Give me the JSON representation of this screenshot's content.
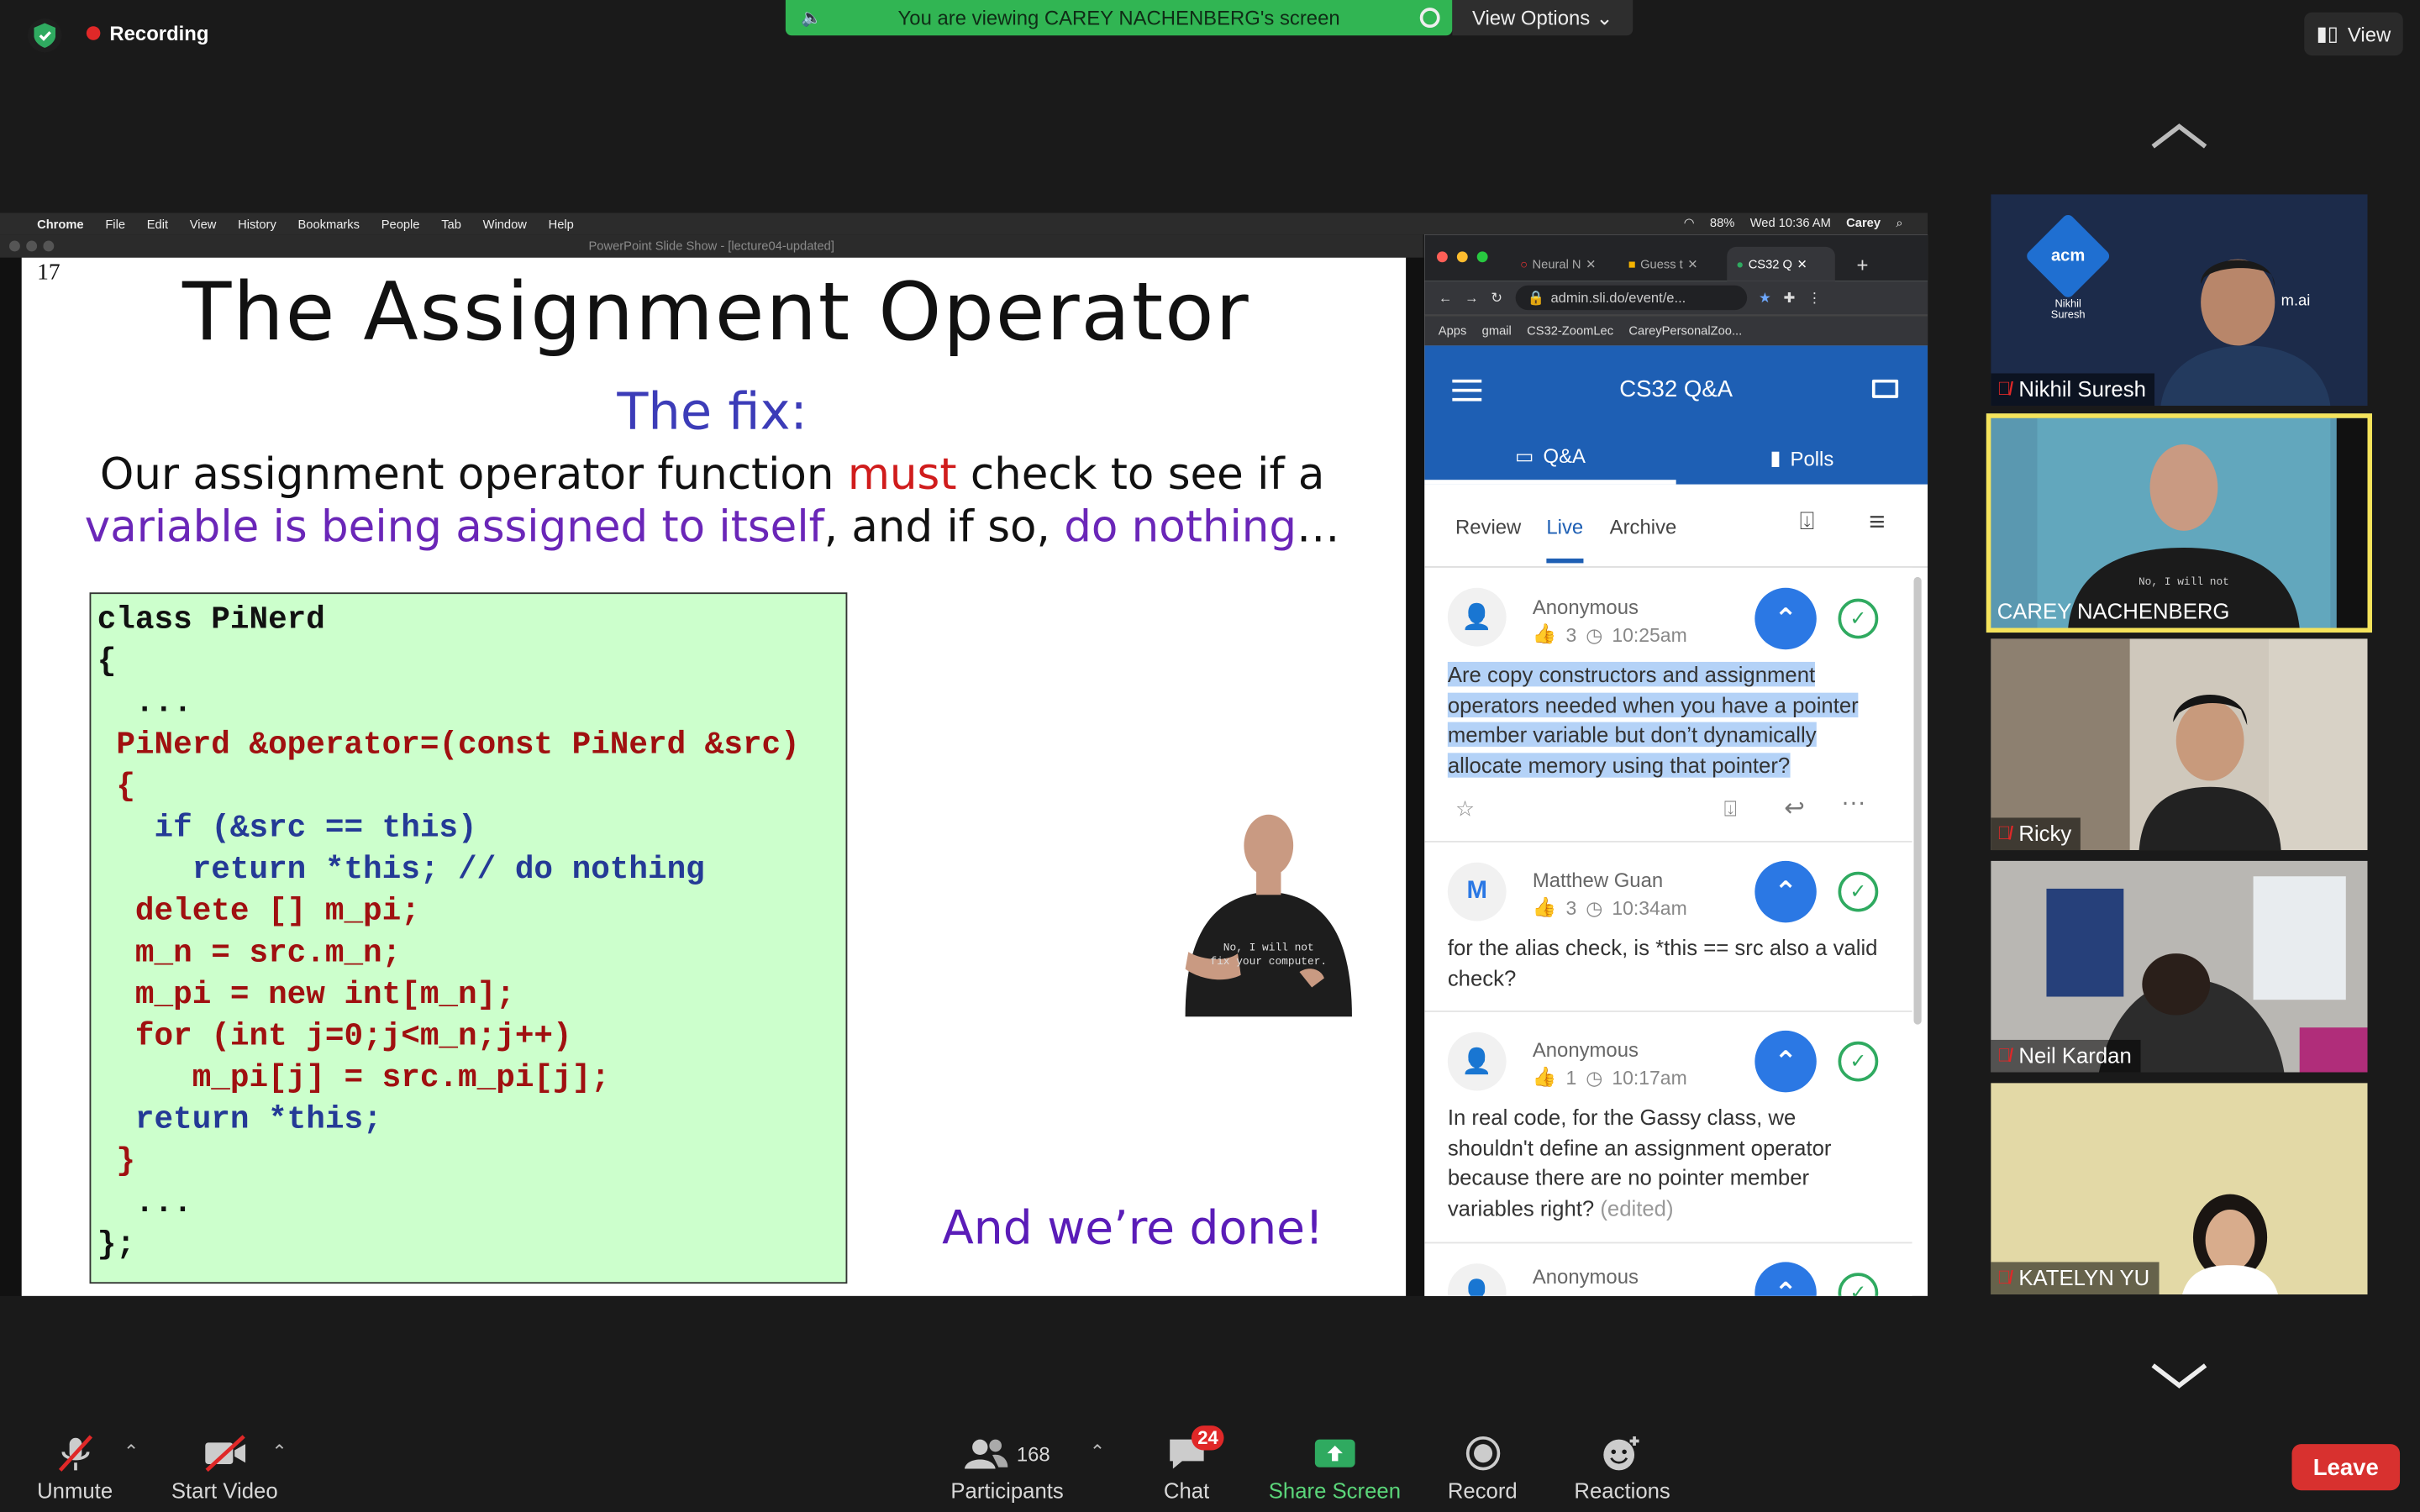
{
  "zoom": {
    "recording_label": "Recording",
    "banner_text": "You are viewing CAREY NACHENBERG's screen",
    "view_options_label": "View Options",
    "view_label": "View",
    "toolbar": {
      "unmute": "Unmute",
      "start_video": "Start Video",
      "participants_count": "168",
      "participants": "Participants",
      "chat": "Chat",
      "chat_badge": "24",
      "share_screen": "Share Screen",
      "record": "Record",
      "reactions": "Reactions",
      "leave": "Leave"
    },
    "gallery": [
      {
        "name": "Nikhil Suresh",
        "muted": true
      },
      {
        "name": "CAREY NACHENBERG",
        "muted": false,
        "active": true
      },
      {
        "name": "Ricky",
        "muted": true
      },
      {
        "name": "Neil Kardan",
        "muted": true
      },
      {
        "name": "KATELYN YU",
        "muted": true
      }
    ],
    "acm_logo": "acm",
    "acm_sub": "Nikhil\nSuresh",
    "acm_right": "m.ai"
  },
  "mac_menu": {
    "app": "Chrome",
    "items": [
      "File",
      "Edit",
      "View",
      "History",
      "Bookmarks",
      "People",
      "Tab",
      "Window",
      "Help"
    ],
    "battery": "88%",
    "clock": "Wed 10:36 AM",
    "user": "Carey"
  },
  "ppt": {
    "window_title": "PowerPoint Slide Show - [lecture04-updated]",
    "slide_number": "17",
    "title": "The Assignment Operator",
    "subtitle": "The fix:",
    "line1_a": "Our assignment operator function ",
    "line1_must": "must",
    "line1_b": " check to see if a",
    "line2_a": "variable is being assigned to itself",
    "line2_b": ", and if so, ",
    "line2_c": "do nothing",
    "line2_d": "…",
    "done": "And we’re done!",
    "shirt_text": "No, I will not fix your computer."
  },
  "chrome": {
    "tabs": [
      "Neural N",
      "Guess t",
      "CS32 Q"
    ],
    "url": "admin.sli.do/event/e...",
    "bookmarks": [
      "Apps",
      "gmail",
      "CS32-ZoomLec",
      "CareyPersonalZoo..."
    ]
  },
  "slido": {
    "title": "CS32 Q&A",
    "tab_qa": "Q&A",
    "tab_polls": "Polls",
    "sub_review": "Review",
    "sub_live": "Live",
    "sub_archive": "Archive",
    "questions": [
      {
        "author": "Anonymous",
        "avatar": "",
        "likes": "3",
        "time": "10:25am",
        "text": "Are copy constructors and assignment operators needed when you have a pointer member variable but don’t dynamically allocate memory using that pointer?"
      },
      {
        "author": "Matthew Guan",
        "avatar": "M",
        "likes": "3",
        "time": "10:34am",
        "text": "for the alias check, is *this == src also a valid check?"
      },
      {
        "author": "Anonymous",
        "avatar": "",
        "likes": "1",
        "time": "10:17am",
        "text": "In real code, for the Gassy class, we shouldn't define an assignment operator because there are no pointer member variables right?",
        "edited": "(edited)"
      },
      {
        "author": "Anonymous",
        "avatar": "",
        "likes": "",
        "time": "",
        "text": ""
      }
    ]
  }
}
